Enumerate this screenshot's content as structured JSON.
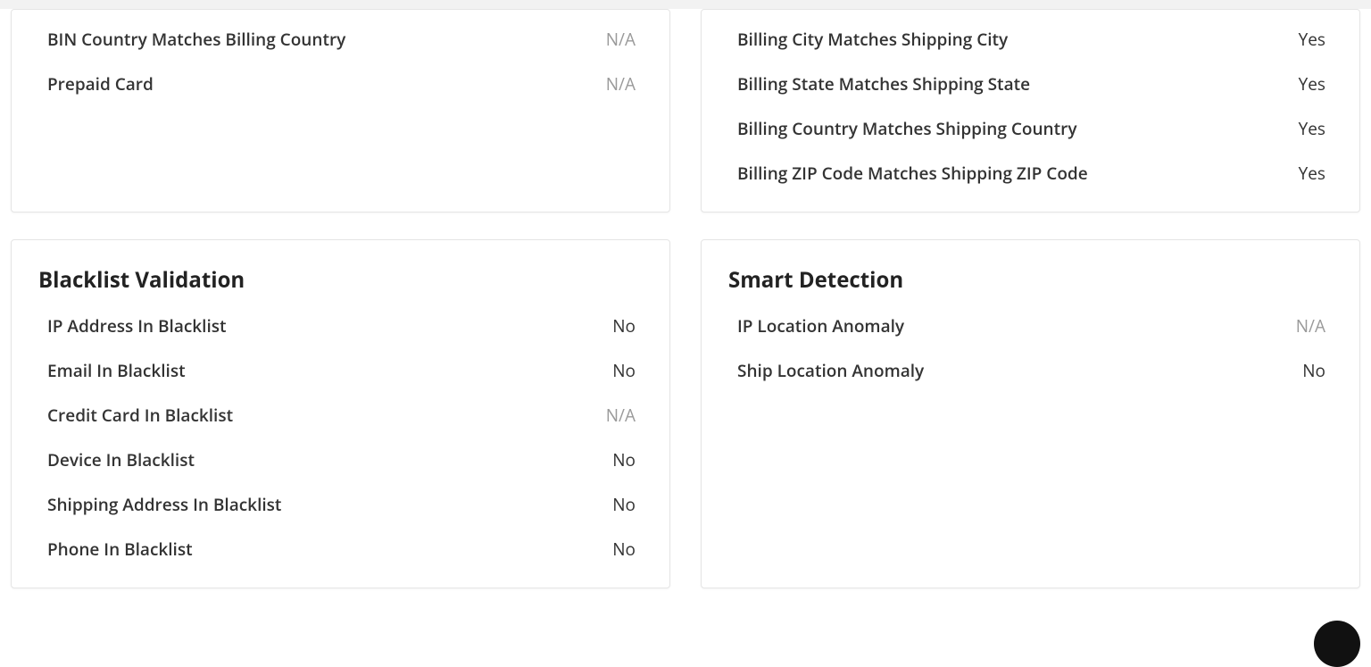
{
  "cards": {
    "topLeft": {
      "rows": [
        {
          "label": "BIN Country Matches Billing Country",
          "value": "N/A",
          "na": true
        },
        {
          "label": "Prepaid Card",
          "value": "N/A",
          "na": true
        }
      ]
    },
    "topRight": {
      "rows": [
        {
          "label": "Billing City Matches Shipping City",
          "value": "Yes",
          "na": false
        },
        {
          "label": "Billing State Matches Shipping State",
          "value": "Yes",
          "na": false
        },
        {
          "label": "Billing Country Matches Shipping Country",
          "value": "Yes",
          "na": false
        },
        {
          "label": "Billing ZIP Code Matches Shipping ZIP Code",
          "value": "Yes",
          "na": false
        }
      ]
    },
    "blacklist": {
      "title": "Blacklist Validation",
      "rows": [
        {
          "label": "IP Address In Blacklist",
          "value": "No",
          "na": false
        },
        {
          "label": "Email In Blacklist",
          "value": "No",
          "na": false
        },
        {
          "label": "Credit Card In Blacklist",
          "value": "N/A",
          "na": true
        },
        {
          "label": "Device In Blacklist",
          "value": "No",
          "na": false
        },
        {
          "label": "Shipping Address In Blacklist",
          "value": "No",
          "na": false
        },
        {
          "label": "Phone In Blacklist",
          "value": "No",
          "na": false
        }
      ]
    },
    "smart": {
      "title": "Smart Detection",
      "rows": [
        {
          "label": "IP Location Anomaly",
          "value": "N/A",
          "na": true
        },
        {
          "label": "Ship Location Anomaly",
          "value": "No",
          "na": false
        }
      ]
    }
  }
}
